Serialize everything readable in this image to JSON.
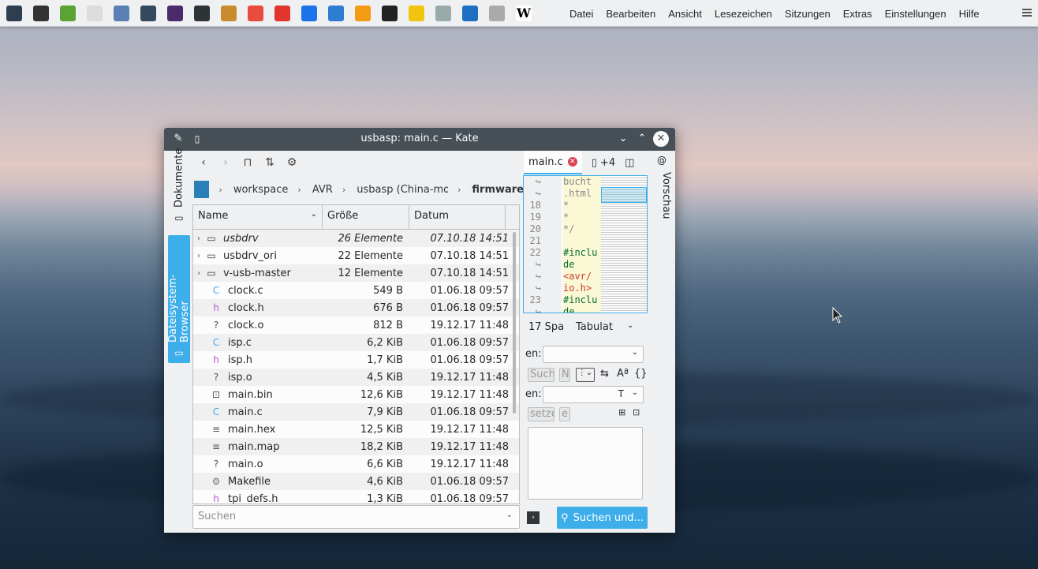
{
  "menu": [
    "Datei",
    "Bearbeiten",
    "Ansicht",
    "Lesezeichen",
    "Sitzungen",
    "Extras",
    "Einstellungen",
    "Hilfe"
  ],
  "taskbar_icons": [
    "app-icon",
    "save-icon",
    "usb-icon",
    "document-icon",
    "atom-icon",
    "network-icon",
    "tex-icon",
    "terminal-icon",
    "map-icon",
    "wave-icon",
    "anydesk-icon",
    "teamviewer-icon",
    "ve-icon",
    "fruit-icon",
    "clapper-icon",
    "star-icon",
    "disk-icon",
    "window-icon",
    "torch-icon",
    "wikipedia-icon"
  ],
  "window": {
    "title": "usbasp: main.c — Kate"
  },
  "sidebar": {
    "tab_documents": "Dokumente",
    "tab_filesystem": "Dateisystem-Browser"
  },
  "breadcrumb": [
    "workspace",
    "AVR",
    "usbasp (China-mod)",
    "firmware"
  ],
  "table": {
    "headers": {
      "name": "Name",
      "size": "Größe",
      "date": "Datum"
    },
    "rows": [
      {
        "name": "usbdrv",
        "size": "26 Elemente",
        "date": "07.10.18 14:51",
        "type": "folder",
        "italic": true
      },
      {
        "name": "usbdrv_ori",
        "size": "22 Elemente",
        "date": "07.10.18 14:51",
        "type": "folder"
      },
      {
        "name": "v-usb-master",
        "size": "12 Elemente",
        "date": "07.10.18 14:51",
        "type": "folder"
      },
      {
        "name": "clock.c",
        "size": "549 B",
        "date": "01.06.18 09:57",
        "type": "c"
      },
      {
        "name": "clock.h",
        "size": "676 B",
        "date": "01.06.18 09:57",
        "type": "h"
      },
      {
        "name": "clock.o",
        "size": "812 B",
        "date": "19.12.17 11:48",
        "type": "o"
      },
      {
        "name": "isp.c",
        "size": "6,2 KiB",
        "date": "01.06.18 09:57",
        "type": "c"
      },
      {
        "name": "isp.h",
        "size": "1,7 KiB",
        "date": "01.06.18 09:57",
        "type": "h"
      },
      {
        "name": "isp.o",
        "size": "4,5 KiB",
        "date": "19.12.17 11:48",
        "type": "o"
      },
      {
        "name": "main.bin",
        "size": "12,6 KiB",
        "date": "19.12.17 11:48",
        "type": "bin"
      },
      {
        "name": "main.c",
        "size": "7,9 KiB",
        "date": "01.06.18 09:57",
        "type": "c"
      },
      {
        "name": "main.hex",
        "size": "12,5 KiB",
        "date": "19.12.17 11:48",
        "type": "txt"
      },
      {
        "name": "main.map",
        "size": "18,2 KiB",
        "date": "19.12.17 11:48",
        "type": "txt"
      },
      {
        "name": "main.o",
        "size": "6,6 KiB",
        "date": "19.12.17 11:48",
        "type": "o"
      },
      {
        "name": "Makefile",
        "size": "4,6 KiB",
        "date": "01.06.18 09:57",
        "type": "make"
      },
      {
        "name": "tpi_defs.h",
        "size": "1,3 KiB",
        "date": "01.06.18 09:57",
        "type": "h"
      }
    ]
  },
  "search": {
    "placeholder": "Suchen"
  },
  "tabs": {
    "active": "main.c",
    "more": "+4"
  },
  "editor": {
    "line_numbers": [
      "↪",
      "↪",
      "18",
      "19",
      "20",
      "21",
      "22",
      "↪",
      "↪",
      "↪",
      "23",
      "↪"
    ],
    "code": [
      "bucht",
      ".html",
      "*",
      "*",
      "*/",
      "",
      "#inclu",
      "de",
      "<avr/",
      "io.h>",
      "#inclu",
      "de"
    ]
  },
  "preview_tab": "Vorschau",
  "find_panel": {
    "line1": "17 Spa",
    "line1b": "Tabulat",
    "label_search": "en:",
    "label_replace": "en:",
    "btn_search": "Such",
    "btn_ne": "Ne",
    "btn_replace": "setze",
    "btn_e": "e",
    "search_button": "Suchen und..."
  },
  "colors": {
    "accent": "#3daee9",
    "titlebar": "#475057"
  }
}
